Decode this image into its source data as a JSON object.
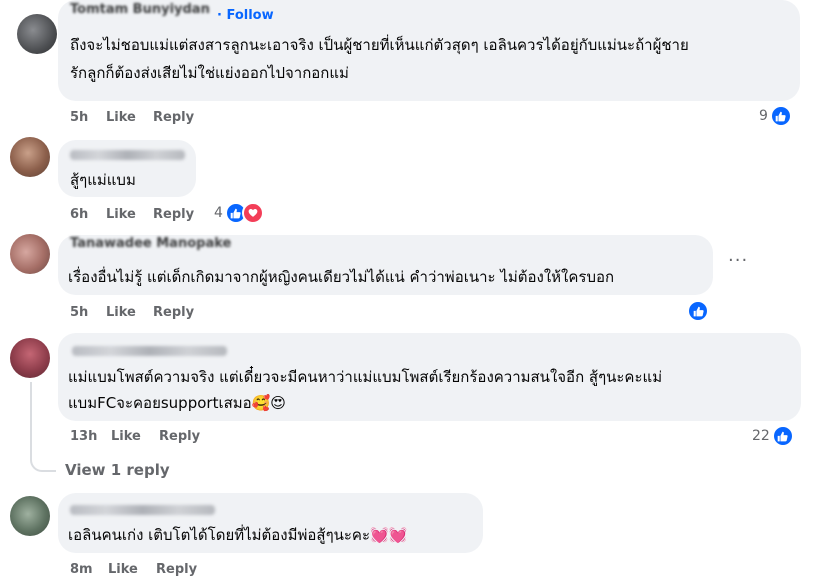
{
  "comments": [
    {
      "author": "Tomtam Bunyiydan",
      "follow": "Follow",
      "lines": [
        "ถึงจะไม่ชอบแม่แต่สงสารลูกนะเอาจริง เป็นผู้ชายที่เห็นแก่ตัวสุดๆ เอลินควรได้อยู่กับแม่นะถ้าผู้ชาย",
        "รักลูกก็ต้องส่งเสียไม่ใช่แย่งออกไปจากอกแม่"
      ],
      "time": "5h",
      "like": "Like",
      "reply": "Reply",
      "reactions": "9"
    },
    {
      "lines": [
        "สู้ๆแม่แบม"
      ],
      "time": "6h",
      "like": "Like",
      "reply": "Reply",
      "reactions": "4"
    },
    {
      "author": "Tanawadee Manopake",
      "lines": [
        "เรื่องอื่นไม่รู้ แต่เด็กเกิดมาจากผู้หญิงคนเดียวไม่ได้แน่ คำว่าพ่อเนาะ ไม่ต้องให้ใครบอก"
      ],
      "time": "5h",
      "like": "Like",
      "reply": "Reply",
      "more": "···"
    },
    {
      "lines": [
        "แม่แบมโพสต์ความจริง แต่เดี๋ยวจะมีคนหาว่าแม่แบมโพสต์เรียกร้องความสนใจอีก สู้ๆนะคะแม่",
        "แบมFCจะคอยsupportเสมอ🥰😍"
      ],
      "time": "13h",
      "like": "Like",
      "reply": "Reply",
      "reactions": "22"
    },
    {
      "lines": [
        "เอลินคนเก่ง เติบโตได้โดยที่ไม่ต้องมีพ่อสู้ๆนะคะ💓💓"
      ],
      "time": "8m",
      "like": "Like",
      "reply": "Reply"
    }
  ],
  "view_replies": "View 1 reply",
  "colors": {
    "bubble": "#f0f2f5",
    "link": "#0866ff",
    "meta": "#65676b",
    "love": "#f33e58"
  }
}
